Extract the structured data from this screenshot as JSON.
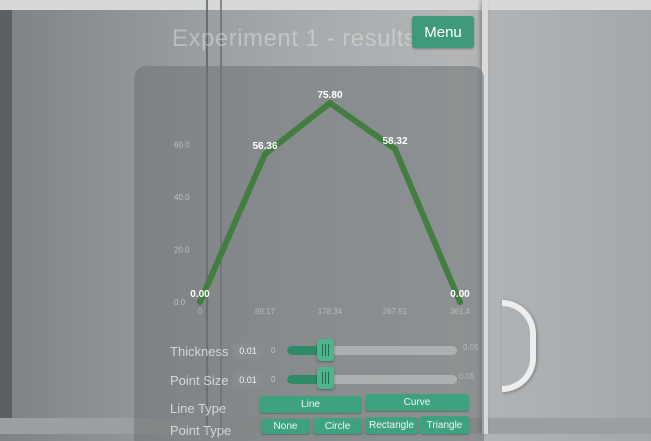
{
  "header": {
    "title": "Experiment 1 - results",
    "menu_label": "Menu"
  },
  "chart_data": {
    "type": "line",
    "x": [
      0,
      89.17,
      178.34,
      267.51,
      356.68
    ],
    "x_tick_labels": [
      "0",
      "89.17",
      "178.34",
      "267.51",
      "361.4"
    ],
    "y_tick_labels": [
      "0.0",
      "20.0",
      "40.0",
      "60.0"
    ],
    "ylim": [
      0,
      80
    ],
    "series": [
      {
        "values": [
          0.0,
          56.36,
          75.8,
          58.32,
          0.0
        ]
      }
    ],
    "data_labels": [
      "0.00",
      "56.36",
      "75.80",
      "58.32",
      "0.00"
    ],
    "line_color": "#3f7d3c",
    "grid": false
  },
  "controls": {
    "thickness": {
      "label": "Thickness",
      "value": "0.01",
      "min": "0",
      "max": "0.05",
      "fraction": 0.2
    },
    "point_size": {
      "label": "Point Size",
      "value": "0.01",
      "min": "0",
      "max": "0.05",
      "fraction": 0.2
    },
    "line_type": {
      "label": "Line Type",
      "options": [
        "Line",
        "Curve"
      ]
    },
    "point_type": {
      "label": "Point Type",
      "options": [
        "None",
        "Circle",
        "Rectangle",
        "Triangle"
      ]
    }
  },
  "colors": {
    "accent": "#3e9a79",
    "slider_fill": "#2f8a68"
  }
}
